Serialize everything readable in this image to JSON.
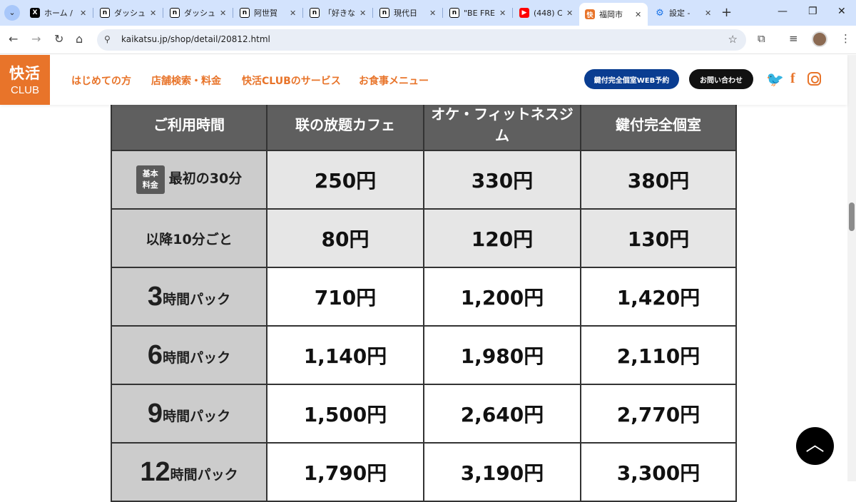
{
  "browser": {
    "tabs": [
      {
        "title": "ホーム / ",
        "favicon": "x-icon"
      },
      {
        "title": "ダッシュ",
        "favicon": "note-icon"
      },
      {
        "title": "ダッシュ",
        "favicon": "note-icon"
      },
      {
        "title": "阿世賀",
        "favicon": "note-icon"
      },
      {
        "title": "「好きな",
        "favicon": "note-icon"
      },
      {
        "title": "現代日",
        "favicon": "note-icon"
      },
      {
        "title": "\"BE FRE",
        "favicon": "note-icon"
      },
      {
        "title": "(448) C",
        "favicon": "youtube-icon"
      },
      {
        "title": "福岡市",
        "favicon": "kaikatsu-icon"
      },
      {
        "title": "設定 - ",
        "favicon": "settings-icon"
      }
    ],
    "url": "kaikatsu.jp/shop/detail/20812.html"
  },
  "site": {
    "logo_top": "快活",
    "logo_bottom": "CLUB",
    "nav": [
      "はじめての方",
      "店舗検索・料金",
      "快活CLUBのサービス",
      "お食事メニュー"
    ],
    "reserve_button": "鍵付完全個室WEB予約",
    "contact_button": "お問い合わせ"
  },
  "table": {
    "headers": [
      "ご利用時間",
      "联の放题カフェ",
      "オケ・フィットネスジム",
      "鍵付完全個室"
    ],
    "rows": [
      {
        "badge": "基本料金",
        "label": "最初の30分",
        "values": [
          "250円",
          "330円",
          "380円"
        ]
      },
      {
        "label": "以降10分ごと",
        "values": [
          "80円",
          "120円",
          "130円"
        ]
      },
      {
        "num": "3",
        "unit": "時間パック",
        "values": [
          "710円",
          "1,200円",
          "1,420円"
        ]
      },
      {
        "num": "6",
        "unit": "時間パック",
        "values": [
          "1,140円",
          "1,980円",
          "2,110円"
        ]
      },
      {
        "num": "9",
        "unit": "時間パック",
        "values": [
          "1,500円",
          "2,640円",
          "2,770円"
        ]
      },
      {
        "num": "12",
        "unit": "時間パック",
        "values": [
          "1,790円",
          "3,190円",
          "3,300円"
        ]
      }
    ]
  },
  "colors": {
    "brand": "#e8742a",
    "reserve": "#0a3d91"
  }
}
